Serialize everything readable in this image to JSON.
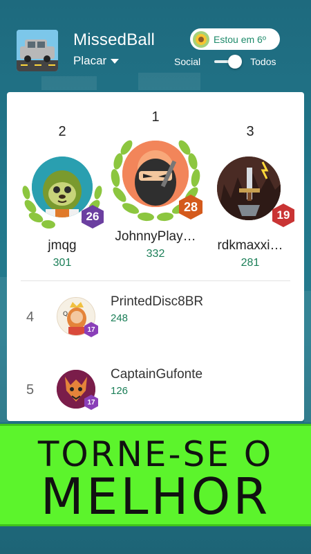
{
  "header": {
    "app_title": "MissedBall",
    "leaderboard_label": "Placar",
    "rank_chip_text": "Estou em 6º",
    "filter": {
      "left_label": "Social",
      "right_label": "Todos",
      "selected": "Todos"
    }
  },
  "podium": [
    {
      "rank": "2",
      "name": "jmqg",
      "score": "301",
      "level": "26",
      "badge_color": "#6b3fa0"
    },
    {
      "rank": "1",
      "name": "JohnnyPlay…",
      "score": "332",
      "level": "28",
      "badge_color": "#d45a1c"
    },
    {
      "rank": "3",
      "name": "rdkmaxxi…",
      "score": "281",
      "level": "19",
      "badge_color": "#c93434"
    }
  ],
  "list": [
    {
      "rank": "4",
      "name": "PrintedDisc8BR",
      "score": "248",
      "level": "17",
      "badge_color": "#8a3fb8"
    },
    {
      "rank": "5",
      "name": "CaptainGufonte",
      "score": "126",
      "level": "17",
      "badge_color": "#8a3fb8"
    }
  ],
  "banner": {
    "line1": "TORNE-SE O",
    "line2": "MELHOR"
  },
  "colors": {
    "accent_green": "#1a7e57",
    "banner_bg": "#5cf42c",
    "background": "#1f6c80"
  },
  "icons": {
    "app_icon": "car-icon",
    "rank_chip_icon": "sunflower-icon",
    "leaderboard_dropdown": "caret-down-icon",
    "wreath": "laurel-wreath-icon",
    "avatar_1": "sloth-avatar-icon",
    "avatar_2": "ninja-avatar-icon",
    "avatar_3": "sword-avatar-icon",
    "avatar_4": "queen-avatar-icon",
    "avatar_5": "dragon-avatar-icon"
  }
}
